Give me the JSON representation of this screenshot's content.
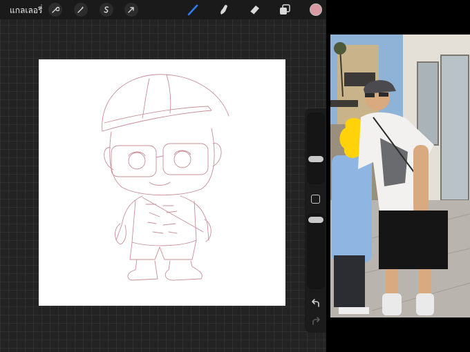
{
  "toolbar": {
    "gallery_label": "แกลเลอรี่",
    "tools": [
      "wrench-icon",
      "magic-wand-icon",
      "selection-icon",
      "transform-icon"
    ],
    "painting_tools": [
      "brush-icon",
      "smudge-icon",
      "eraser-icon",
      "layers-icon"
    ],
    "active_tool": "brush-icon",
    "current_color": "#d99aa4",
    "accent": "#2f7cf6"
  },
  "side_panel": {
    "controls": [
      "brush-size-slider",
      "modify-button",
      "opacity-slider",
      "undo-icon",
      "redo-icon"
    ]
  },
  "reference": {
    "type": "photo",
    "subjects": [
      "person",
      "person-with-obscured-face"
    ]
  }
}
